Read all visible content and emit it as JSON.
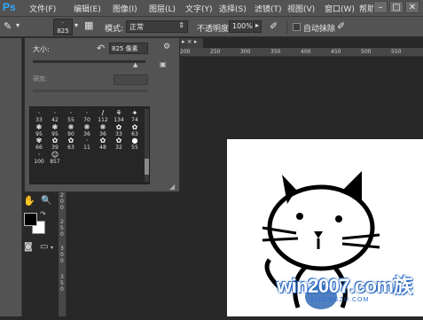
{
  "app": {
    "logo": "Ps"
  },
  "menu": [
    "文件(F)",
    "编辑(E)",
    "图像(I)",
    "图层(L)",
    "文字(Y)",
    "选择(S)",
    "滤镜(T)",
    "视图(V)",
    "窗口(W)",
    "帮助(H)"
  ],
  "window_controls": [
    "–",
    "□",
    "✕"
  ],
  "options_bar": {
    "brush_size": "825",
    "mode_label": "模式:",
    "mode_value": "正常",
    "opacity_label": "不透明度:",
    "opacity_value": "100%",
    "auto_erase_label": "自动抹除"
  },
  "doc_tab": "▸ × ▸",
  "brush_panel": {
    "size_label": "大小:",
    "size_value": "825 像素",
    "hardness_label": "硬度:",
    "presets": [
      {
        "glyph": "·",
        "num": "33"
      },
      {
        "glyph": "·",
        "num": "42"
      },
      {
        "glyph": "·",
        "num": "55"
      },
      {
        "glyph": "·",
        "num": "70"
      },
      {
        "glyph": "/",
        "num": "112"
      },
      {
        "glyph": "⚘",
        "num": "134"
      },
      {
        "glyph": "✦",
        "num": "74"
      },
      {
        "glyph": "❃",
        "num": "95"
      },
      {
        "glyph": "❃",
        "num": "95"
      },
      {
        "glyph": "❋",
        "num": "90"
      },
      {
        "glyph": "❋",
        "num": "36"
      },
      {
        "glyph": "❋",
        "num": "36"
      },
      {
        "glyph": "✿",
        "num": "33"
      },
      {
        "glyph": "✿",
        "num": "63"
      },
      {
        "glyph": "✾",
        "num": "66"
      },
      {
        "glyph": "✿",
        "num": "39"
      },
      {
        "glyph": "✿",
        "num": "63"
      },
      {
        "glyph": "·",
        "num": "11"
      },
      {
        "glyph": "✿",
        "num": "48"
      },
      {
        "glyph": "✿",
        "num": "32"
      },
      {
        "glyph": "●",
        "num": "55"
      },
      {
        "glyph": "·",
        "num": "100"
      },
      {
        "glyph": "☺",
        "num": "857"
      }
    ]
  },
  "ruler_top": [
    "200",
    "250",
    "300",
    "350",
    "400",
    "450",
    "500",
    "550"
  ],
  "ruler_left": [
    "2",
    "0",
    "0",
    "2",
    "5",
    "0",
    "3",
    "0",
    "0",
    "3",
    "5",
    "0"
  ],
  "watermark": {
    "main": "win2007.com族",
    "sub": "XITONGZU.COM"
  }
}
